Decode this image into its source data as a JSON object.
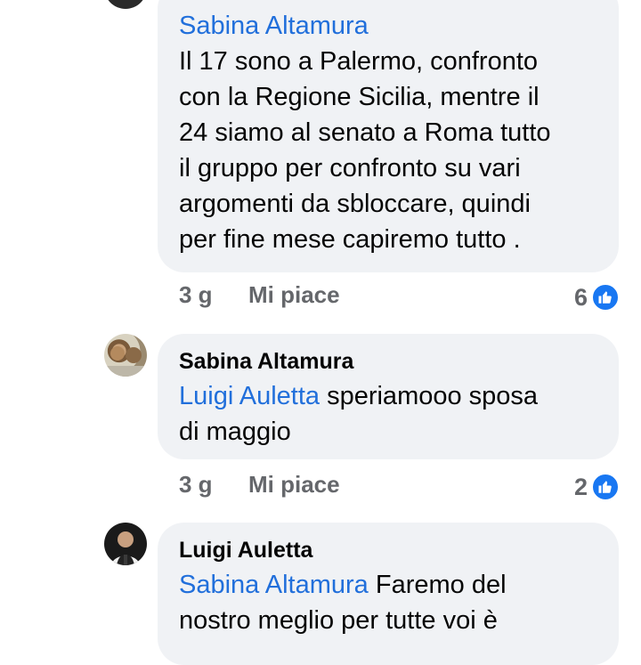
{
  "comments": [
    {
      "mention": "Sabina Altamura",
      "text_lines": [
        "Il 17 sono a Palermo, confronto",
        "con la Regione Sicilia, mentre il",
        "24 siamo al senato a Roma tutto",
        "il gruppo per confronto su vari",
        "argomenti da sbloccare, quindi",
        "per fine mese capiremo tutto ."
      ],
      "time": "3 g",
      "like_label": "Mi piace",
      "reaction_count": "6"
    },
    {
      "author": "Sabina Altamura",
      "mention": "Luigi Auletta",
      "text_first": "speriamooo sposa",
      "text_rest": "di maggio",
      "time": "3 g",
      "like_label": "Mi piace",
      "reaction_count": "2"
    },
    {
      "author": "Luigi Auletta",
      "mention": "Sabina Altamura",
      "text_first": "Faremo del",
      "text_rest": "nostro meglio per tutte voi è"
    }
  ],
  "icons": {
    "reaction": "like-thumb-icon",
    "accent": "#1877f2",
    "mention_color": "#216fdb"
  }
}
